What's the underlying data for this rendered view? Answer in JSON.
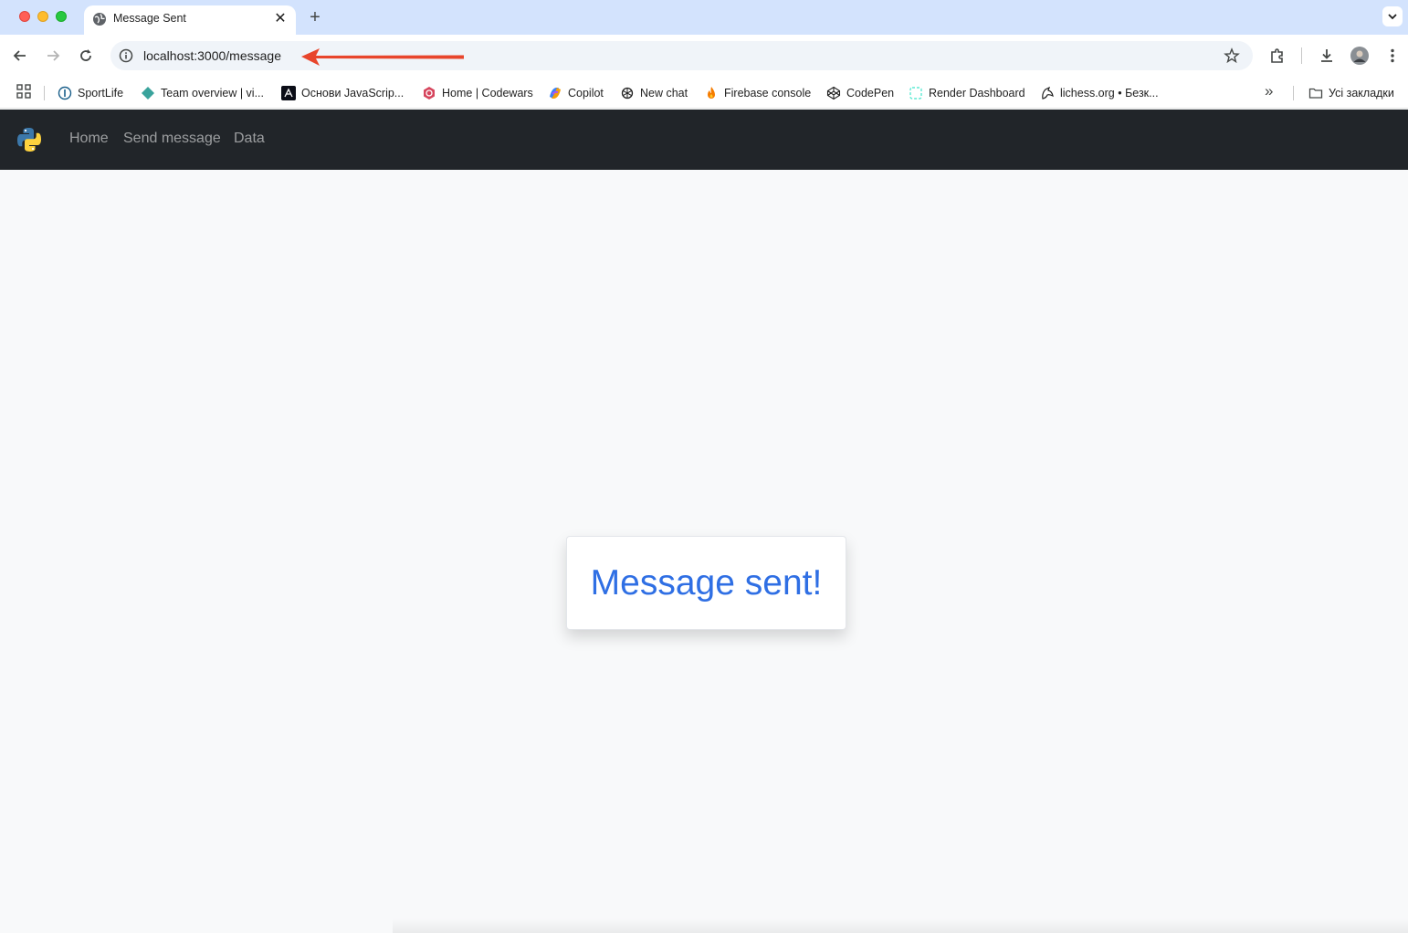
{
  "browser": {
    "tab": {
      "title": "Message Sent",
      "favicon": "globe-icon",
      "close": "✕"
    },
    "new_tab": "+",
    "toolbar": {
      "back": "arrow-left-icon",
      "forward": "arrow-right-icon",
      "reload": "reload-icon",
      "url": "localhost:3000/message",
      "info": "info-icon",
      "bookmark_star": "star-icon",
      "extensions": "puzzle-icon",
      "downloads": "download-icon",
      "profile": "avatar",
      "menu": "more-vert-icon"
    },
    "bookmarks": [
      {
        "label": "SportLife",
        "icon": "sportlife-icon"
      },
      {
        "label": "Team overview | vi...",
        "icon": "diamond-icon"
      },
      {
        "label": "Основи JavaScrip...",
        "icon": "lambda-icon"
      },
      {
        "label": "Home | Codewars",
        "icon": "codewars-icon"
      },
      {
        "label": "Copilot",
        "icon": "copilot-icon"
      },
      {
        "label": "New chat",
        "icon": "openai-icon"
      },
      {
        "label": "Firebase console",
        "icon": "firebase-icon"
      },
      {
        "label": "CodePen",
        "icon": "codepen-icon"
      },
      {
        "label": "Render Dashboard",
        "icon": "render-icon"
      },
      {
        "label": "lichess.org • Безк...",
        "icon": "lichess-icon"
      }
    ],
    "more_bookmarks": "»",
    "all_bookmarks": "Усі закладки",
    "annotation": "red-arrow-icon"
  },
  "navbar": {
    "brand": "python-logo-icon",
    "links": [
      "Home",
      "Send message",
      "Data"
    ]
  },
  "main": {
    "message": "Message sent!"
  },
  "colors": {
    "tabstrip": "#d3e3fd",
    "navbar": "#212529",
    "page_bg": "#f8f9fa",
    "message_text": "#2f6fe4",
    "annotation_arrow": "#e8452c"
  }
}
